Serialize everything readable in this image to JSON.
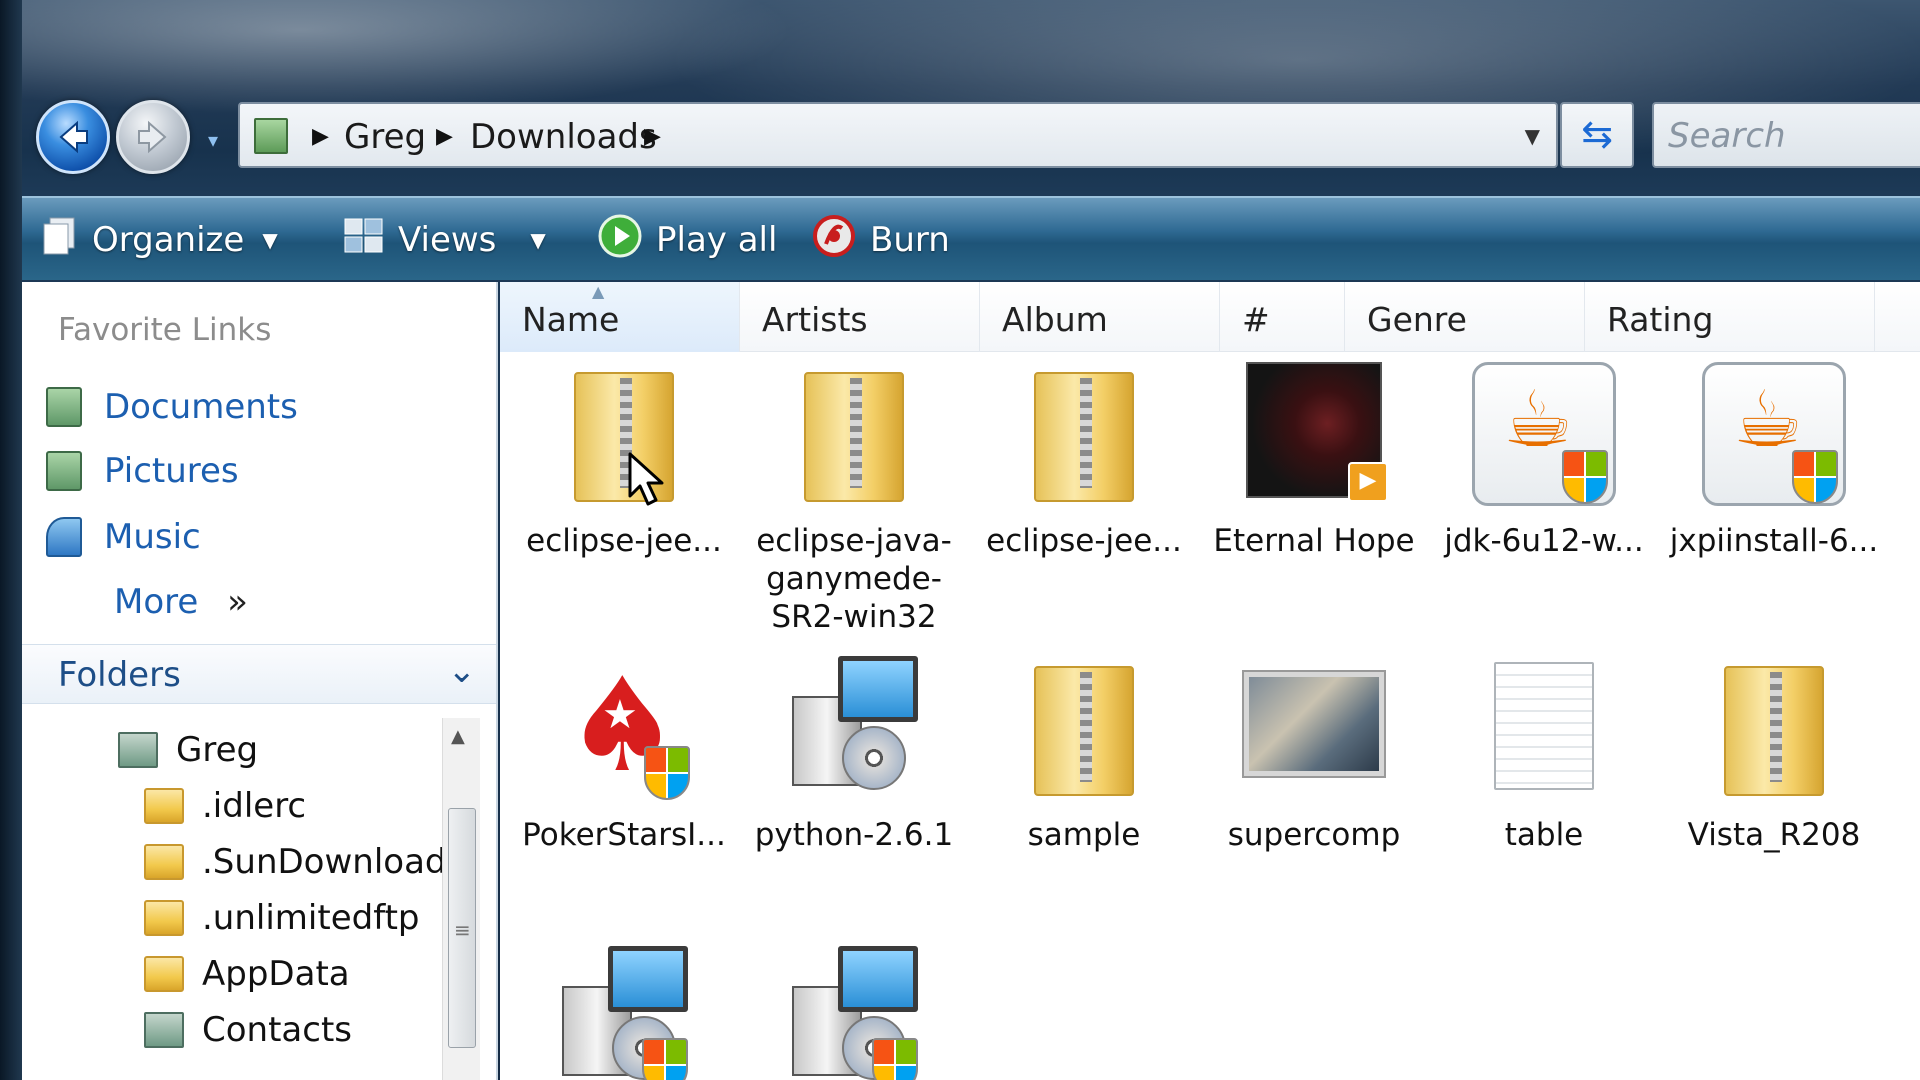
{
  "address": {
    "crumbs": [
      "Greg",
      "Downloads"
    ]
  },
  "search": {
    "placeholder": "Search"
  },
  "toolbar": {
    "organize": "Organize",
    "views": "Views",
    "play_all": "Play all",
    "burn": "Burn"
  },
  "navpane": {
    "favorites_title": "Favorite Links",
    "favorites": [
      "Documents",
      "Pictures",
      "Music"
    ],
    "more": "More",
    "more_glyph": "»",
    "folders_title": "Folders",
    "tree": [
      "Greg",
      ".idlerc",
      ".SunDownload",
      ".unlimitedftp",
      "AppData",
      "Contacts"
    ]
  },
  "columns": [
    "Name",
    "Artists",
    "Album",
    "#",
    "Genre",
    "Rating"
  ],
  "files": [
    {
      "label": "eclipse-jee...",
      "icon": "folder-icon"
    },
    {
      "label": "eclipse-java-ganymede-SR2-win32",
      "icon": "zip-folder-icon"
    },
    {
      "label": "eclipse-jee...",
      "icon": "zip-folder-icon"
    },
    {
      "label": "Eternal Hope",
      "icon": "video-thumbnail-icon"
    },
    {
      "label": "jdk-6u12-w...",
      "icon": "java-installer-icon"
    },
    {
      "label": "jxpiinstall-6...",
      "icon": "java-installer-icon"
    },
    {
      "label": "PokerStarsI...",
      "icon": "pokerstars-icon"
    },
    {
      "label": "python-2.6.1",
      "icon": "installer-icon"
    },
    {
      "label": "sample",
      "icon": "zip-folder-icon"
    },
    {
      "label": "supercomp",
      "icon": "image-thumbnail-icon"
    },
    {
      "label": "table",
      "icon": "text-document-icon"
    },
    {
      "label": "Vista_R208",
      "icon": "zip-folder-icon"
    },
    {
      "label": "",
      "icon": "installer-icon"
    },
    {
      "label": "",
      "icon": "installer-icon"
    }
  ]
}
